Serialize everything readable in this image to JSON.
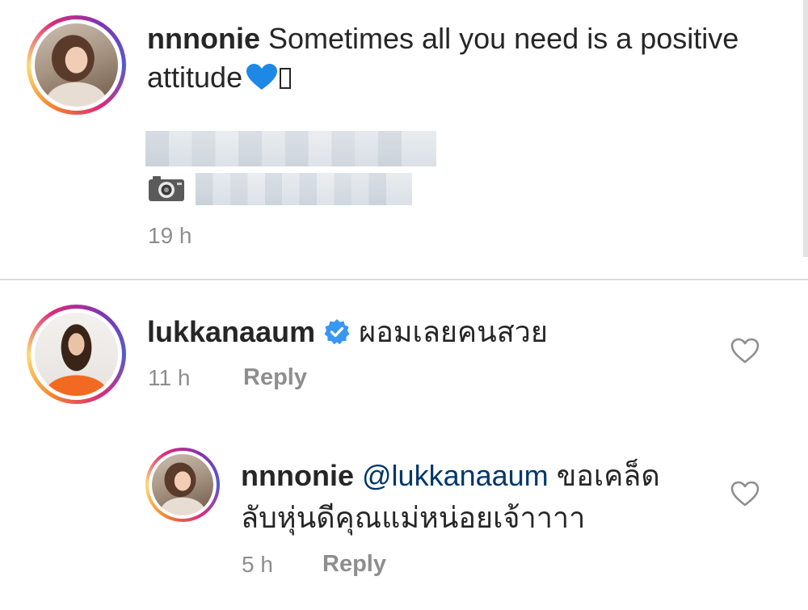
{
  "post": {
    "username": "nnnonie",
    "caption_text": "Sometimes all you need is a positive attitude",
    "emoji": "blue-heart-emoji",
    "time": "19 h"
  },
  "comments": [
    {
      "username": "lukkanaaum",
      "verified": true,
      "text": "ผอมเลยคนสวย",
      "time": "11 h",
      "reply_label": "Reply"
    }
  ],
  "replies": [
    {
      "username": "nnnonie",
      "mention": "@lukkanaaum",
      "text_line1": "ขอเคล็ด",
      "text_line2": "ลับหุ่นดีคุณแม่หน่อยเจ้าาาา",
      "time": "5 h",
      "reply_label": "Reply"
    }
  ],
  "icons": {
    "like": "heart-outline-icon",
    "camera": "camera-icon",
    "verified": "verified-badge-icon"
  },
  "colors": {
    "text": "#262626",
    "secondary": "#8e8e8e",
    "mention": "#00376b",
    "verified": "#3897f0",
    "divider": "#dbdbdb"
  }
}
